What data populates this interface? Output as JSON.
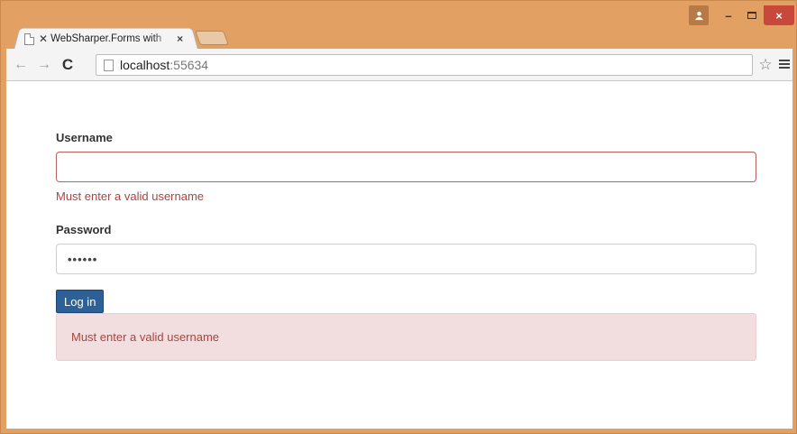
{
  "browser": {
    "tab_title": "WebSharper.Forms with",
    "tab_prefix_glyph": "✕",
    "tab_close": "×",
    "url_host": "localhost",
    "url_port": ":55634",
    "window_controls": {
      "minimize": "–",
      "close": "×"
    }
  },
  "form": {
    "username_label": "Username",
    "username_value": "",
    "username_error": "Must enter a valid username",
    "password_label": "Password",
    "password_value": "••••••",
    "login_label": "Log in",
    "alert_message": "Must enter a valid username"
  },
  "colors": {
    "frame": "#e2a062",
    "error_text": "#a94442",
    "alert_bg": "#f2dede",
    "primary_button": "#2d6097"
  }
}
